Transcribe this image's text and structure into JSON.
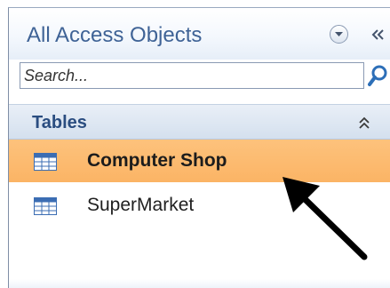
{
  "nav_pane": {
    "title": "All Access Objects",
    "search": {
      "placeholder": "Search...",
      "value": ""
    },
    "groups": [
      {
        "label": "Tables",
        "items": [
          {
            "label": "Computer Shop",
            "icon": "table-icon",
            "selected": true
          },
          {
            "label": "SuperMarket",
            "icon": "table-icon",
            "selected": false
          }
        ]
      }
    ]
  },
  "colors": {
    "title_text": "#3f6396",
    "group_text": "#2a4d80",
    "selection": "#fbb465",
    "header_bg": "#e6eef8",
    "arrow": "#000000"
  }
}
